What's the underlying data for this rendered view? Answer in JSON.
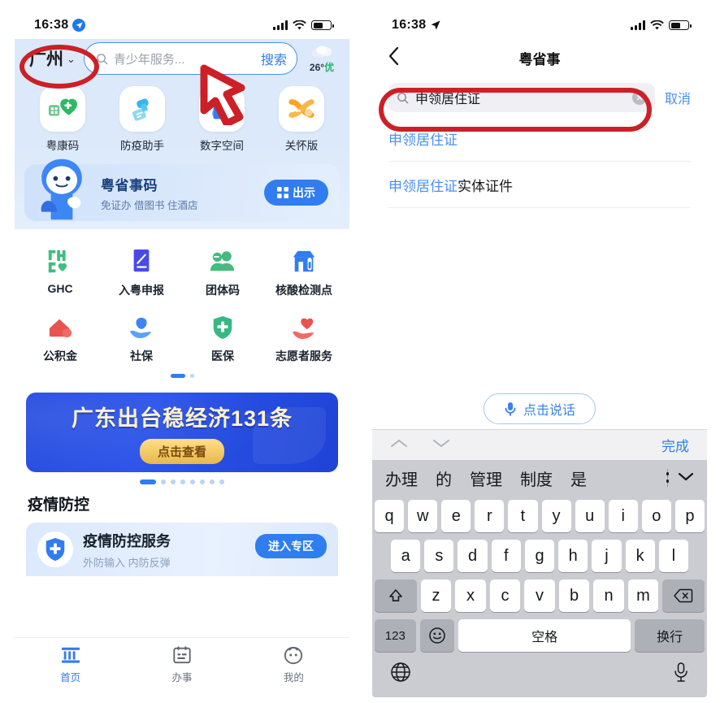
{
  "left_phone": {
    "status": {
      "time": "16:38",
      "location_icon": "location-arrow-icon",
      "signal": "signal-bars-icon",
      "wifi": "wifi-icon",
      "battery": "battery-icon"
    },
    "header": {
      "city": "广州",
      "city_chevron": "⌄",
      "search_placeholder": "青少年服务...",
      "search_button": "搜索",
      "search_icon": "search-icon",
      "weather_icon": "cloud-icon",
      "weather_temp": "26°",
      "weather_quality": "优"
    },
    "quick_actions": [
      {
        "label": "粤康码",
        "icon": "green-heart-qr-icon"
      },
      {
        "label": "防疫助手",
        "icon": "blue-spray-icon"
      },
      {
        "label": "数字空间",
        "icon": "blue-folder-icon"
      },
      {
        "label": "关怀版",
        "icon": "orange-ribbon-icon"
      }
    ],
    "code_card": {
      "title": "粤省事码",
      "subtitle": "免证办 借图书 住酒店",
      "button": "出示",
      "button_icon": "qr-code-icon",
      "mascot": "blue-mascot-icon"
    },
    "service_grid": {
      "row1": [
        {
          "label": "GHC",
          "icon": "ghc-logo-icon"
        },
        {
          "label": "入粤申报",
          "icon": "declaration-pen-icon"
        },
        {
          "label": "团体码",
          "icon": "group-people-icon"
        },
        {
          "label": "核酸检测点",
          "icon": "test-site-icon"
        }
      ],
      "row2": [
        {
          "label": "公积金",
          "icon": "house-fund-icon"
        },
        {
          "label": "社保",
          "icon": "social-security-icon"
        },
        {
          "label": "医保",
          "icon": "medical-shield-icon"
        },
        {
          "label": "志愿者服务",
          "icon": "volunteer-heart-hand-icon"
        }
      ],
      "page_dots": 2,
      "active_dot": 0
    },
    "banner": {
      "title": "广东出台稳经济131条",
      "button": "点击查看",
      "dots": 8,
      "active_dot": 0
    },
    "section": {
      "title": "疫情防控",
      "card_title": "疫情防控服务",
      "card_subtitle": "外防输入 内防反弹",
      "card_button": "进入专区",
      "card_icon": "shield-cross-icon"
    },
    "tabs": [
      {
        "label": "首页",
        "icon": "home-bank-icon",
        "active": true
      },
      {
        "label": "办事",
        "icon": "calendar-tasks-icon",
        "active": false
      },
      {
        "label": "我的",
        "icon": "profile-face-icon",
        "active": false
      }
    ]
  },
  "right_phone": {
    "status": {
      "time": "16:38",
      "location_icon": "location-arrow-icon",
      "signal": "signal-bars-icon",
      "wifi": "wifi-icon",
      "battery": "battery-icon"
    },
    "nav": {
      "back_icon": "chevron-left-icon",
      "title": "粤省事"
    },
    "search": {
      "value": "申领居住证",
      "search_icon": "search-icon",
      "clear_icon": "clear-circle-icon",
      "cancel": "取消"
    },
    "results": [
      {
        "highlight": "申领居住证",
        "rest": ""
      },
      {
        "highlight": "申领居住证",
        "rest": "实体证件"
      }
    ],
    "voice": {
      "label": "点击说话",
      "icon": "microphone-icon"
    },
    "keyboard": {
      "toolbar": {
        "up_icon": "chevron-up-icon",
        "down_icon": "chevron-down-icon",
        "done": "完成"
      },
      "candidates": [
        "办理",
        "的",
        "管理",
        "制度",
        "是"
      ],
      "expand_icon": "chevron-down-icon",
      "row1": [
        "q",
        "w",
        "e",
        "r",
        "t",
        "y",
        "u",
        "i",
        "o",
        "p"
      ],
      "row2": [
        "a",
        "s",
        "d",
        "f",
        "g",
        "h",
        "j",
        "k",
        "l"
      ],
      "row3": [
        "z",
        "x",
        "c",
        "v",
        "b",
        "n",
        "m"
      ],
      "shift_icon": "shift-up-icon",
      "backspace_icon": "backspace-icon",
      "numbers_key": "123",
      "emoji_key": "emoji-smiley-icon",
      "space_key": "空格",
      "return_key": "换行",
      "globe_icon": "globe-icon",
      "mic_icon": "microphone-icon"
    }
  },
  "annotations": {
    "city_circle": "red-ellipse-highlight",
    "search_circle": "red-ellipse-highlight",
    "cursor": "red-outlined-cursor-arrow"
  },
  "colors": {
    "accent_blue": "#2f7df0",
    "link_blue": "#4a90f2",
    "annotation_red": "#cc2026",
    "banner_blue": "#2148df",
    "gold": "#e8b74a",
    "green": "#27b36a"
  }
}
